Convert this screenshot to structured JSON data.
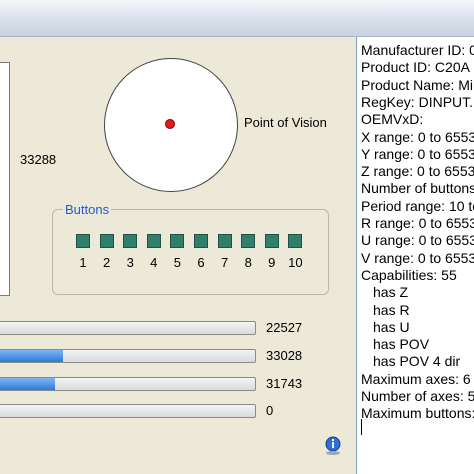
{
  "left": {
    "value_main": "33288",
    "pov_label": "Point of Vision",
    "buttons_legend": "Buttons",
    "buttons": [
      "1",
      "2",
      "3",
      "4",
      "5",
      "6",
      "7",
      "8",
      "9",
      "10"
    ],
    "axes": [
      {
        "value": "22527",
        "fill": 0
      },
      {
        "value": "33028",
        "fill": 0.25
      },
      {
        "value": "31743",
        "fill": 0.22
      },
      {
        "value": "0",
        "fill": 0
      }
    ]
  },
  "right": {
    "lines": [
      "Manufacturer ID: 0",
      "Product ID: C20A",
      "Product Name: Mi",
      "RegKey: DINPUT.",
      "OEMVxD:",
      "X range: 0 to 6553",
      "Y range: 0 to 6553",
      "Z range: 0 to 6553",
      "Number of buttons",
      "Period range: 10 to",
      "R range: 0 to 6553",
      "U range: 0 to 6553",
      "V range: 0 to 6553",
      "Capabilities: 55",
      "  has Z",
      "  has R",
      "  has U",
      "  has POV",
      "  has POV 4 dir",
      "Maximum axes: 6",
      "Number of axes: 5",
      "Maximum buttons:"
    ]
  },
  "colors": {
    "accent": "#1f5bd6",
    "button_square": "#2f7f6a",
    "pov_dot": "#e21b1b",
    "bar_fill": "#2f79d8"
  }
}
